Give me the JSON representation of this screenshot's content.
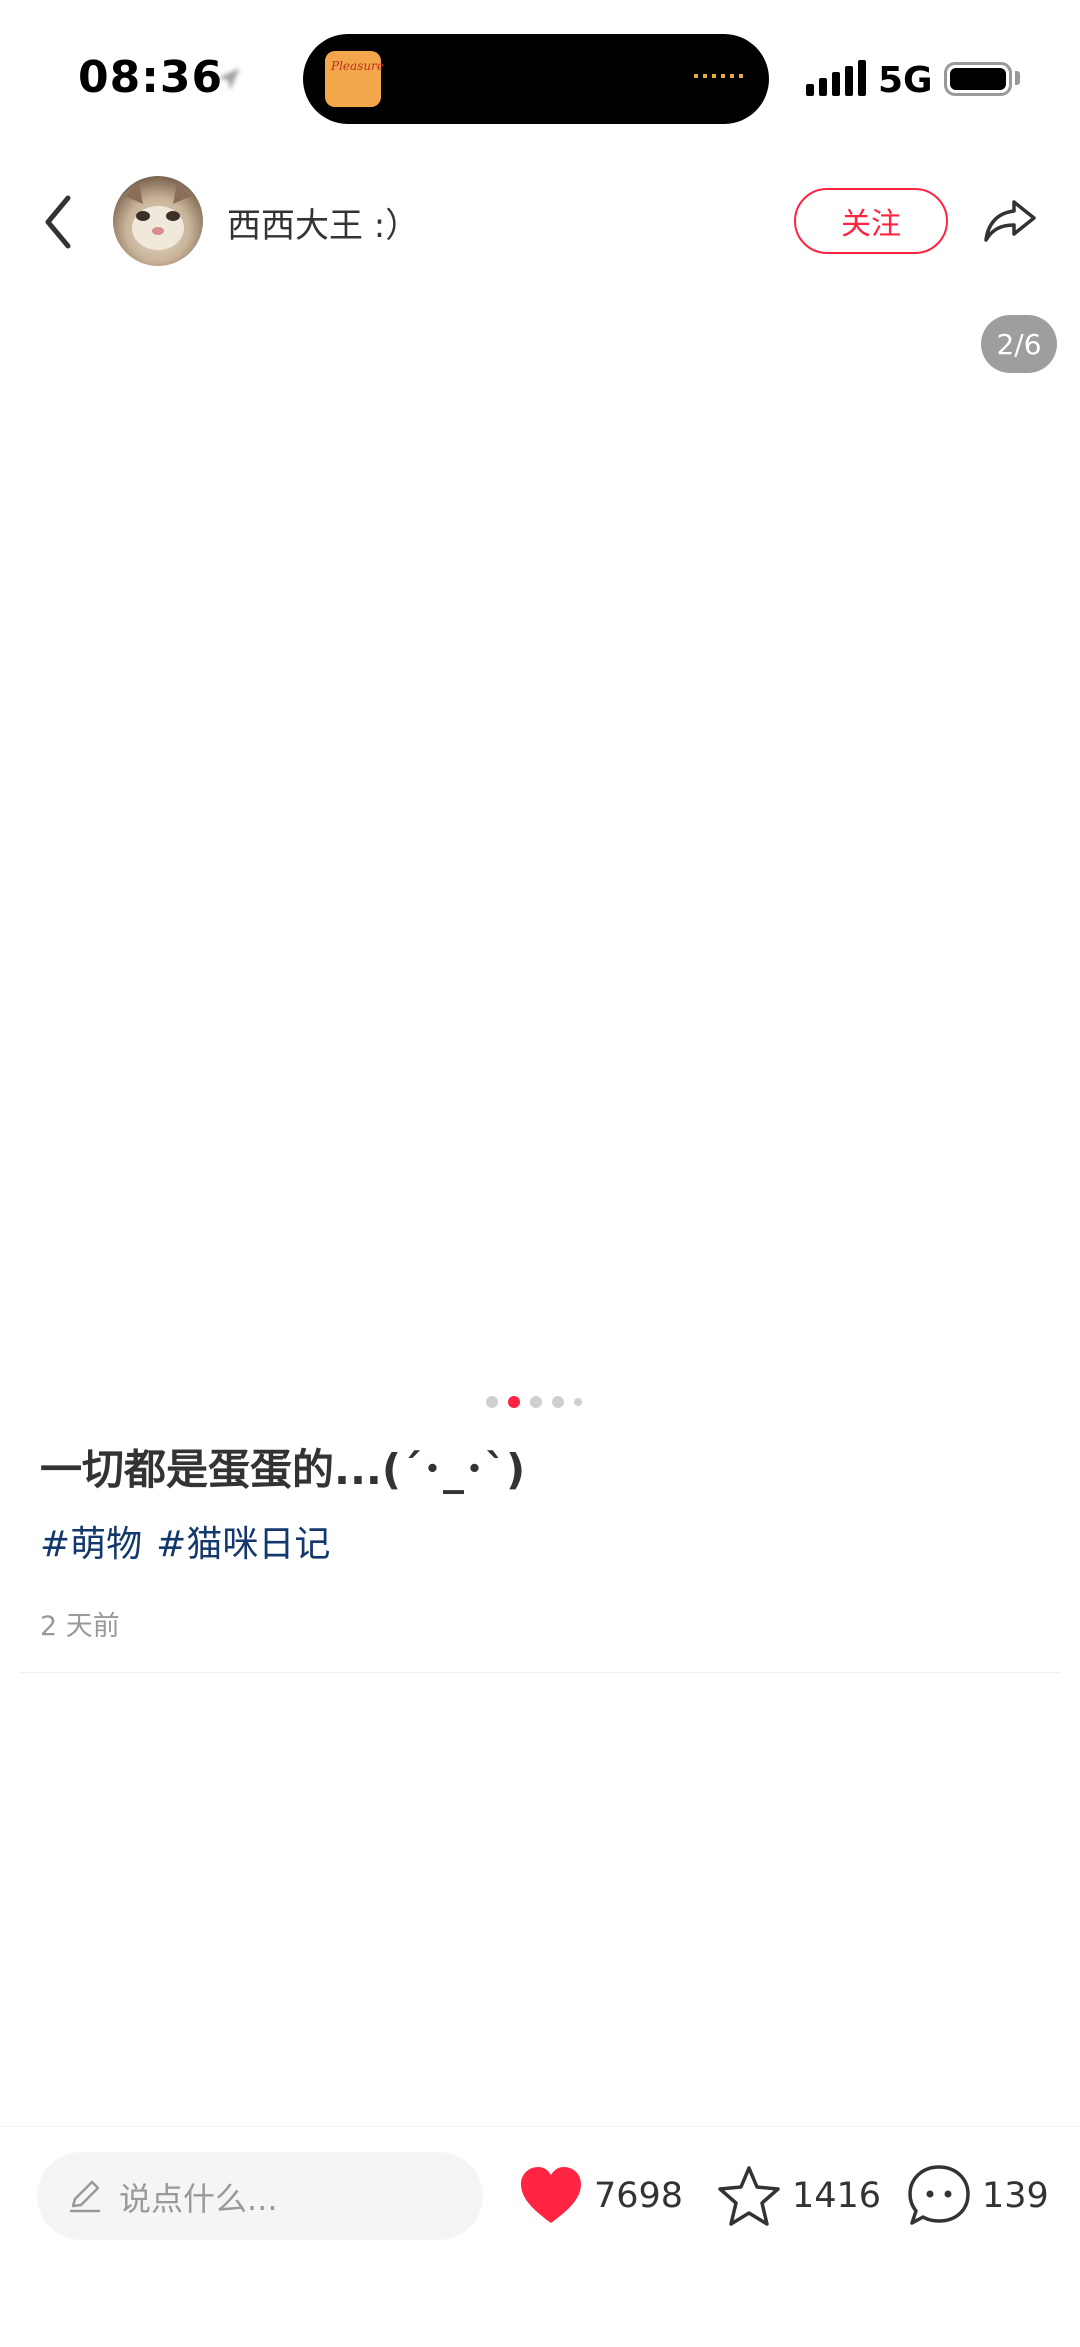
{
  "status_bar": {
    "time": "08:36",
    "network": "5G",
    "island_art_text": "Pleasure"
  },
  "header": {
    "author_name": "西西大王 :）",
    "follow_label": "关注"
  },
  "media": {
    "page_counter": "2/6",
    "current_page": 2,
    "total_pages": 6
  },
  "note": {
    "title": "一切都是蛋蛋的...(´･_･`)",
    "tags": [
      "#萌物",
      "#猫咪日记"
    ],
    "time": "2 天前"
  },
  "bottom_bar": {
    "comment_placeholder": "说点什么...",
    "likes": "7698",
    "collects": "1416",
    "comments": "139"
  },
  "colors": {
    "accent": "#ff2442",
    "tag": "#13386c",
    "muted": "#999999"
  },
  "icons": [
    "back-icon",
    "share-icon",
    "pencil-icon",
    "heart-icon",
    "star-icon",
    "comment-icon"
  ]
}
